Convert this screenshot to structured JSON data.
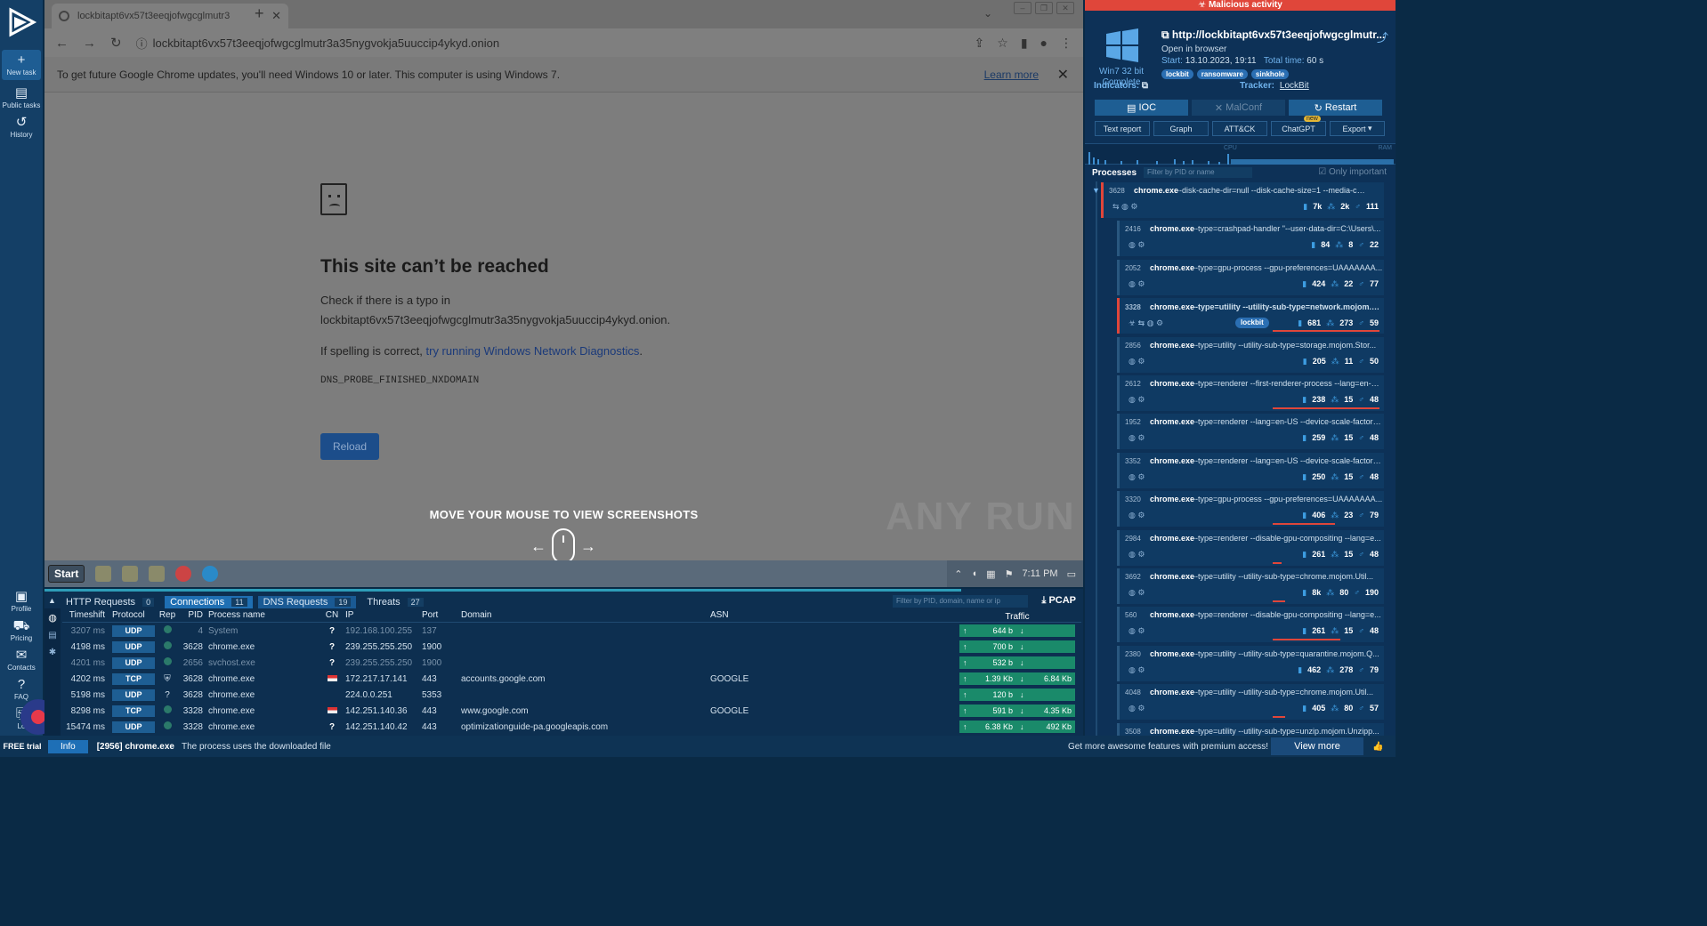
{
  "sidebar": {
    "items": [
      {
        "label": "New task"
      },
      {
        "label": "Public tasks"
      },
      {
        "label": "History"
      },
      {
        "label": "Profile"
      },
      {
        "label": "Pricing"
      },
      {
        "label": "Contacts"
      },
      {
        "label": "FAQ"
      },
      {
        "label": "Lo"
      }
    ],
    "free_trial": "FREE trial"
  },
  "browser": {
    "tab_title": "lockbitapt6vx57t3eeqjofwgcglmutr3",
    "url": "lockbitapt6vx57t3eeqjofwgcglmutr3a35nygvokja5uuccip4ykyd.onion",
    "infobar_text": "To get future Google Chrome updates, you'll need Windows 10 or later. This computer is using Windows 7.",
    "learn_more": "Learn more"
  },
  "error_page": {
    "title": "This site can’t be reached",
    "line1": "Check if there is a typo in",
    "line2": "lockbitapt6vx57t3eeqjofwgcglmutr3a35nygvokja5uuccip4ykyd.onion.",
    "line3_prefix": "If spelling is correct,",
    "line3_link": "try running Windows Network Diagnostics",
    "line3_suffix": ".",
    "code": "DNS_PROBE_FINISHED_NXDOMAIN",
    "reload": "Reload"
  },
  "overlay": {
    "move_mouse": "MOVE YOUR MOUSE TO VIEW SCREENSHOTS",
    "watermark": "ANY RUN"
  },
  "taskbar": {
    "start": "Start",
    "clock": "7:11 PM"
  },
  "bottom_panel": {
    "tabs": [
      {
        "label": "HTTP Requests",
        "count": "0"
      },
      {
        "label": "Connections",
        "count": "11"
      },
      {
        "label": "DNS Requests",
        "count": "19"
      },
      {
        "label": "Threats",
        "count": "27"
      }
    ],
    "filter_placeholder": "Filter by PID, domain, name or ip",
    "pcap": "PCAP",
    "headers": [
      "Timeshift",
      "Protocol",
      "Rep",
      "PID",
      "Process name",
      "CN",
      "IP",
      "Port",
      "Domain",
      "ASN",
      "Traffic"
    ],
    "rows": [
      {
        "ts": "3207 ms",
        "proto": "UDP",
        "rep": "ok",
        "pid": "4",
        "pname": "System",
        "cn": "?",
        "ip": "192.168.100.255",
        "port": "137",
        "domain": "",
        "asn": "",
        "up": "644 b",
        "down": "",
        "dim": true
      },
      {
        "ts": "4198 ms",
        "proto": "UDP",
        "rep": "ok",
        "pid": "3628",
        "pname": "chrome.exe",
        "cn": "?",
        "ip": "239.255.255.250",
        "port": "1900",
        "domain": "",
        "asn": "",
        "up": "700 b",
        "down": "",
        "dim": false
      },
      {
        "ts": "4201 ms",
        "proto": "UDP",
        "rep": "ok",
        "pid": "2656",
        "pname": "svchost.exe",
        "cn": "?",
        "ip": "239.255.255.250",
        "port": "1900",
        "domain": "",
        "asn": "",
        "up": "532 b",
        "down": "",
        "dim": true
      },
      {
        "ts": "4202 ms",
        "proto": "TCP",
        "rep": "shield",
        "pid": "3628",
        "pname": "chrome.exe",
        "cn": "flag",
        "ip": "172.217.17.141",
        "port": "443",
        "domain": "accounts.google.com",
        "asn": "GOOGLE",
        "up": "1.39 Kb",
        "down": "6.84 Kb",
        "dim": false
      },
      {
        "ts": "5198 ms",
        "proto": "UDP",
        "rep": "?",
        "pid": "3628",
        "pname": "chrome.exe",
        "cn": "",
        "ip": "224.0.0.251",
        "port": "5353",
        "domain": "",
        "asn": "",
        "up": "120 b",
        "down": "",
        "dim": false
      },
      {
        "ts": "8298 ms",
        "proto": "TCP",
        "rep": "ok",
        "pid": "3328",
        "pname": "chrome.exe",
        "cn": "flag",
        "ip": "142.251.140.36",
        "port": "443",
        "domain": "www.google.com",
        "asn": "GOOGLE",
        "up": "591 b",
        "down": "4.35 Kb",
        "dim": false
      },
      {
        "ts": "15474 ms",
        "proto": "UDP",
        "rep": "ok",
        "pid": "3328",
        "pname": "chrome.exe",
        "cn": "?",
        "ip": "142.251.140.42",
        "port": "443",
        "domain": "optimizationguide-pa.googleapis.com",
        "asn": "",
        "up": "6.38 Kb",
        "down": "492 Kb",
        "dim": false
      }
    ]
  },
  "statusbar": {
    "info": "Info",
    "process": "[2956] chrome.exe",
    "message": "The process uses the downloaded file",
    "premium": "Get more awesome features with premium access!",
    "view_more": "View more"
  },
  "right_panel": {
    "malicious": "Malicious activity",
    "os_name": "Win7 32 bit",
    "os_status": "Complete",
    "url": "http://lockbitapt6vx57t3eeqjofwgcglmutr...",
    "open_in": "Open in browser",
    "start_label": "Start:",
    "start_value": "13.10.2023, 19:11",
    "total_label": "Total time:",
    "total_value": "60 s",
    "tags": [
      "lockbit",
      "ransomware",
      "sinkhole"
    ],
    "indicators": "Indicators:",
    "tracker_label": "Tracker:",
    "tracker_value": "LockBit",
    "buttons": [
      "IOC",
      "MalConf",
      "Restart"
    ],
    "buttons2": [
      "Text report",
      "Graph",
      "ATT&CK",
      "ChatGPT",
      "Export"
    ],
    "new_badge": "new",
    "cpu": "CPU",
    "ram": "RAM",
    "processes_label": "Processes",
    "filter_placeholder": "Filter by PID or name",
    "only_important": "Only important",
    "processes": [
      {
        "pid": "3628",
        "name": "chrome.exe",
        "cmd": "--disk-cache-dir=null --disk-cache-size=1 --media-cache-...",
        "s1": "7k",
        "s2": "2k",
        "s3": "111",
        "badge": ""
      },
      {
        "pid": "2416",
        "name": "chrome.exe",
        "cmd": "--type=crashpad-handler \"--user-data-dir=C:\\Users\\...",
        "s1": "84",
        "s2": "8",
        "s3": "22",
        "badge": ""
      },
      {
        "pid": "2052",
        "name": "chrome.exe",
        "cmd": "--type=gpu-process --gpu-preferences=UAAAAAAA...",
        "s1": "424",
        "s2": "22",
        "s3": "77",
        "badge": ""
      },
      {
        "pid": "3328",
        "name": "chrome.exe",
        "cmd": "--type=utility --utility-sub-type=network.mojom.Net...",
        "s1": "681",
        "s2": "273",
        "s3": "59",
        "badge": "lockbit"
      },
      {
        "pid": "2856",
        "name": "chrome.exe",
        "cmd": "--type=utility --utility-sub-type=storage.mojom.Stor...",
        "s1": "205",
        "s2": "11",
        "s3": "50",
        "badge": ""
      },
      {
        "pid": "2612",
        "name": "chrome.exe",
        "cmd": "--type=renderer --first-renderer-process --lang=en-U...",
        "s1": "238",
        "s2": "15",
        "s3": "48",
        "badge": ""
      },
      {
        "pid": "1952",
        "name": "chrome.exe",
        "cmd": "--type=renderer --lang=en-US --device-scale-factor=...",
        "s1": "259",
        "s2": "15",
        "s3": "48",
        "badge": ""
      },
      {
        "pid": "3352",
        "name": "chrome.exe",
        "cmd": "--type=renderer --lang=en-US --device-scale-factor=...",
        "s1": "250",
        "s2": "15",
        "s3": "48",
        "badge": ""
      },
      {
        "pid": "3320",
        "name": "chrome.exe",
        "cmd": "--type=gpu-process --gpu-preferences=UAAAAAAA...",
        "s1": "406",
        "s2": "23",
        "s3": "79",
        "badge": ""
      },
      {
        "pid": "2984",
        "name": "chrome.exe",
        "cmd": "--type=renderer --disable-gpu-compositing --lang=e...",
        "s1": "261",
        "s2": "15",
        "s3": "48",
        "badge": ""
      },
      {
        "pid": "3692",
        "name": "chrome.exe",
        "cmd": "--type=utility --utility-sub-type=chrome.mojom.Util...",
        "s1": "8k",
        "s2": "80",
        "s3": "190",
        "badge": ""
      },
      {
        "pid": "560",
        "name": "chrome.exe",
        "cmd": "--type=renderer --disable-gpu-compositing --lang=e...",
        "s1": "261",
        "s2": "15",
        "s3": "48",
        "badge": ""
      },
      {
        "pid": "2380",
        "name": "chrome.exe",
        "cmd": "--type=utility --utility-sub-type=quarantine.mojom.Q...",
        "s1": "462",
        "s2": "278",
        "s3": "79",
        "badge": ""
      },
      {
        "pid": "4048",
        "name": "chrome.exe",
        "cmd": "--type=utility --utility-sub-type=chrome.mojom.Util...",
        "s1": "405",
        "s2": "80",
        "s3": "57",
        "badge": ""
      },
      {
        "pid": "3508",
        "name": "chrome.exe",
        "cmd": "--type=utility --utility-sub-type=unzip.mojom.Unzipp...",
        "s1": "",
        "s2": "",
        "s3": "",
        "badge": ""
      }
    ]
  }
}
